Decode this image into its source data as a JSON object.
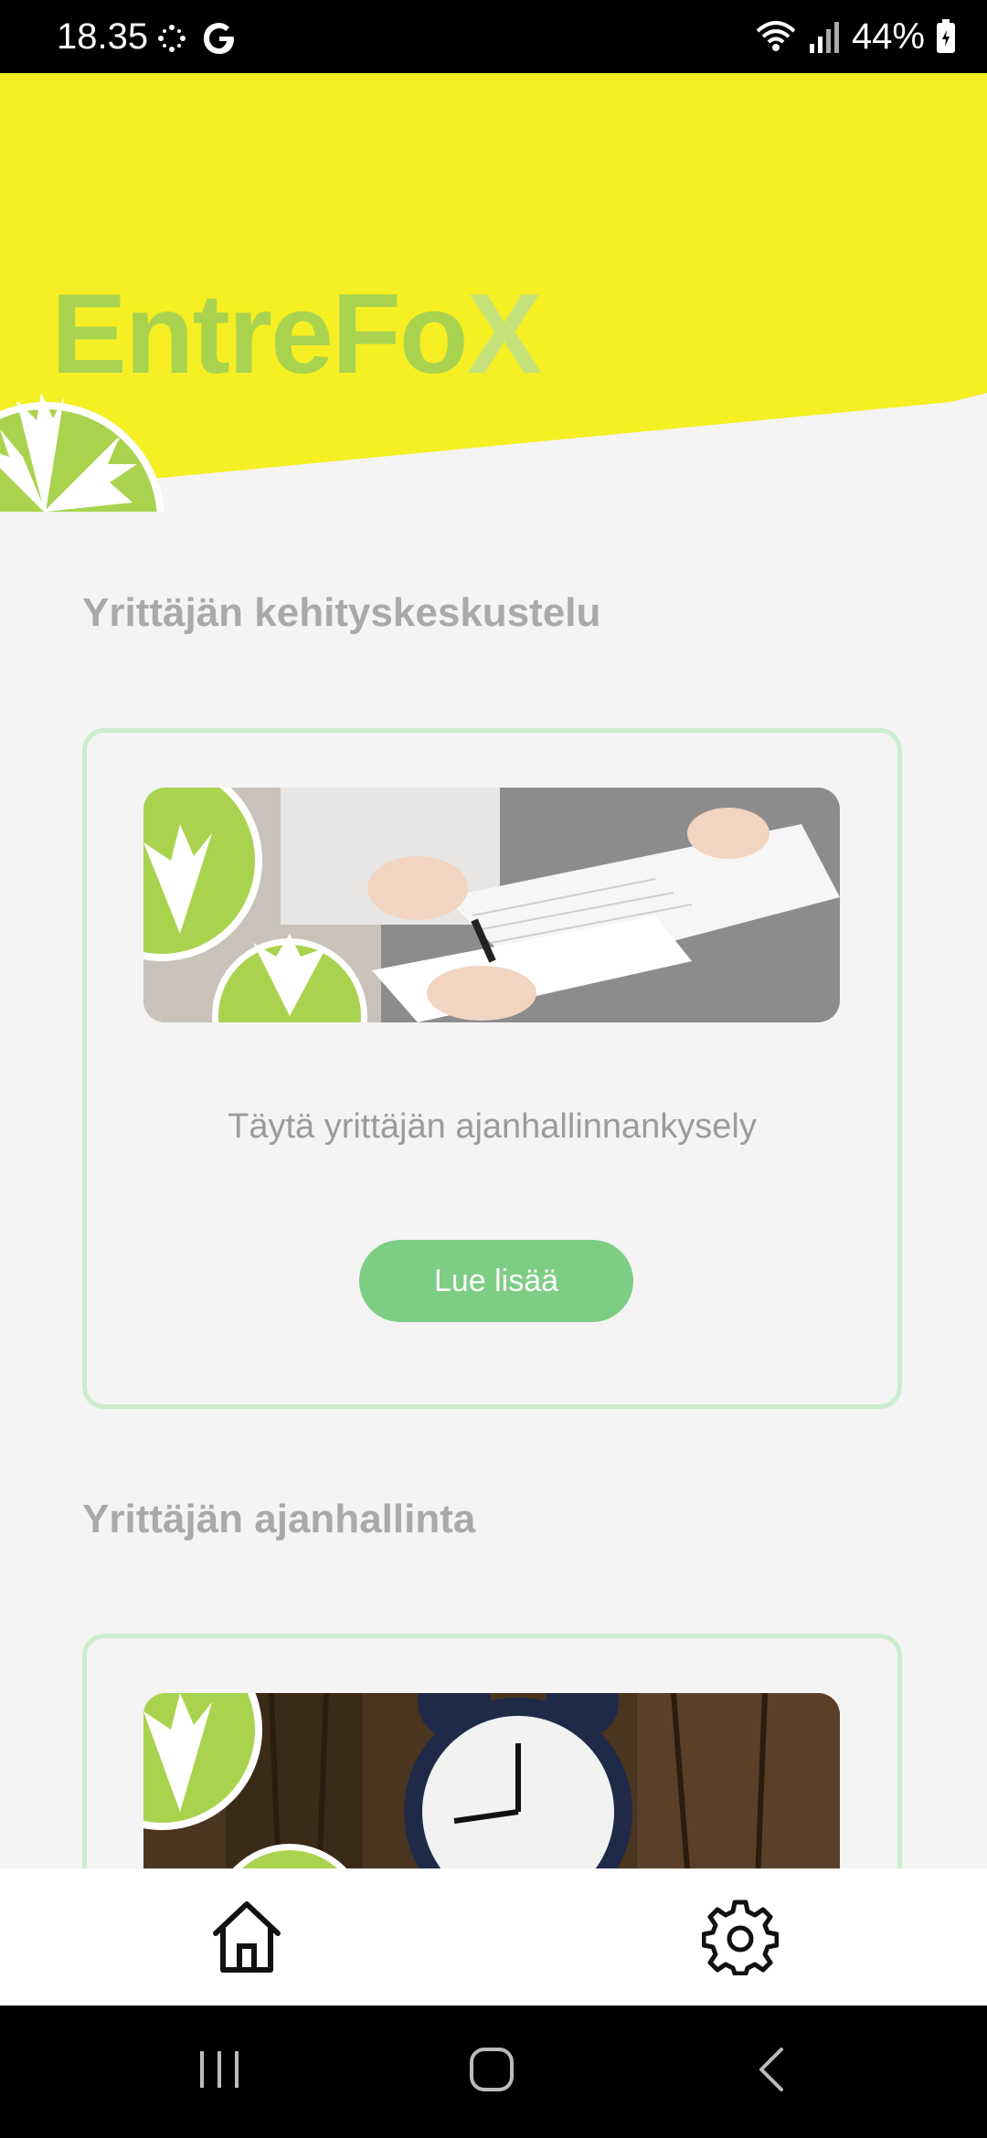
{
  "status_bar": {
    "time": "18.35",
    "battery": "44%",
    "icons": [
      "sparkle-icon",
      "google-icon",
      "wifi-icon",
      "signal-icon",
      "battery-icon"
    ]
  },
  "header": {
    "logo_text": "EntreFo",
    "logo_x": "X",
    "background_color": "#f5ef23",
    "brand_green": "#a9d34e"
  },
  "sections": [
    {
      "title": "Yrittäjän kehityskeskustelu",
      "image_label": "document-signing-photo",
      "description": "Täytä yrittäjän ajanhallinnankysely",
      "button_label": "Lue lisää"
    },
    {
      "title": "Yrittäjän ajanhallinta",
      "image_label": "alarm-clock-photo"
    }
  ],
  "bottom_nav": {
    "items": [
      "home-icon",
      "settings-icon"
    ]
  },
  "system_nav": {
    "items": [
      "recent-apps-icon",
      "home-circle-icon",
      "back-icon"
    ]
  },
  "colors": {
    "accent_button": "#7ecd84",
    "card_border": "#ccecce",
    "section_title": "#a9a9a9"
  }
}
